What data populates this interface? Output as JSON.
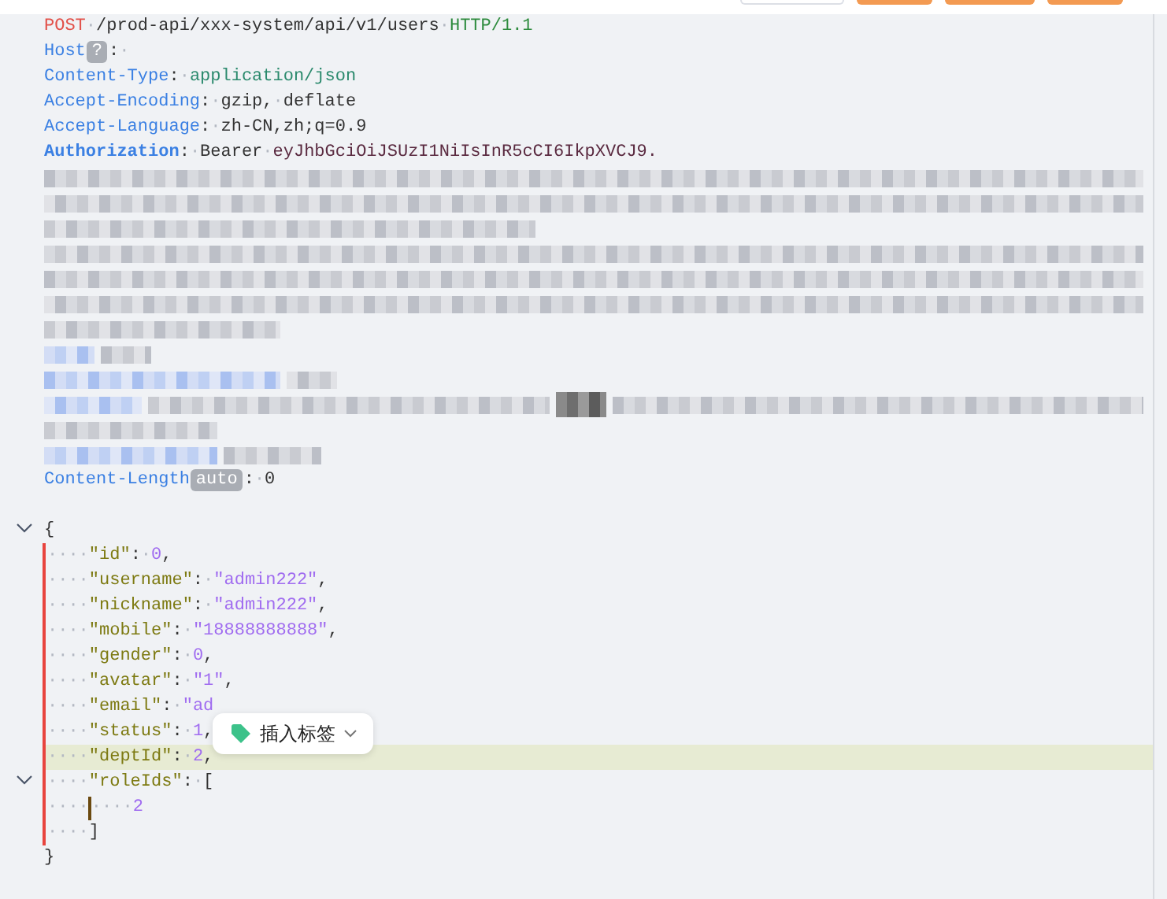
{
  "toolbar": {
    "buttons": [
      {
        "kind": "outline"
      },
      {
        "kind": "primary"
      },
      {
        "kind": "primary"
      },
      {
        "kind": "primary"
      }
    ]
  },
  "editor": {
    "lines": [
      {
        "kind": "code",
        "segments": [
          {
            "kind": "method",
            "text": "POST"
          },
          {
            "kind": "ws",
            "text": "·"
          },
          {
            "kind": "text",
            "text": "/prod-api/xxx-system/api/v1/users"
          },
          {
            "kind": "ws",
            "text": "·"
          },
          {
            "kind": "version",
            "text": "HTTP/1.1"
          }
        ]
      },
      {
        "kind": "code",
        "segments": [
          {
            "kind": "header",
            "text": "Host"
          },
          {
            "kind": "badge",
            "text": "?"
          },
          {
            "kind": "punct",
            "text": ":"
          },
          {
            "kind": "ws",
            "text": "·"
          }
        ]
      },
      {
        "kind": "code",
        "segments": [
          {
            "kind": "header",
            "text": "Content-Type"
          },
          {
            "kind": "punct",
            "text": ":"
          },
          {
            "kind": "ws",
            "text": "·"
          },
          {
            "kind": "mime",
            "text": "application/json"
          }
        ]
      },
      {
        "kind": "code",
        "segments": [
          {
            "kind": "header",
            "text": "Accept-Encoding"
          },
          {
            "kind": "punct",
            "text": ":"
          },
          {
            "kind": "ws",
            "text": "·"
          },
          {
            "kind": "text",
            "text": "gzip,"
          },
          {
            "kind": "ws",
            "text": "·"
          },
          {
            "kind": "text",
            "text": "deflate"
          }
        ]
      },
      {
        "kind": "code",
        "segments": [
          {
            "kind": "header",
            "text": "Accept-Language"
          },
          {
            "kind": "punct",
            "text": ":"
          },
          {
            "kind": "ws",
            "text": "·"
          },
          {
            "kind": "text",
            "text": "zh-CN,zh;q=0.9"
          }
        ]
      },
      {
        "kind": "code",
        "segments": [
          {
            "kind": "header",
            "text": "Authorization"
          },
          {
            "kind": "punct",
            "text": ":"
          },
          {
            "kind": "ws",
            "text": "·"
          },
          {
            "kind": "text",
            "text": "Bearer"
          },
          {
            "kind": "ws",
            "text": "·"
          },
          {
            "kind": "token",
            "text": "eyJhbGciOiJSUzI1NiIsInR5cCI6IkpXVCJ9."
          }
        ]
      },
      {
        "kind": "redacted"
      },
      {
        "kind": "redacted"
      },
      {
        "kind": "redacted"
      },
      {
        "kind": "redacted"
      },
      {
        "kind": "redacted"
      },
      {
        "kind": "redacted"
      },
      {
        "kind": "redacted"
      },
      {
        "kind": "redacted"
      },
      {
        "kind": "redacted"
      },
      {
        "kind": "redacted"
      },
      {
        "kind": "redacted"
      },
      {
        "kind": "redacted"
      },
      {
        "kind": "code",
        "segments": [
          {
            "kind": "header",
            "text": "Content-Length"
          },
          {
            "kind": "badge",
            "text": "auto"
          },
          {
            "kind": "punct",
            "text": ":"
          },
          {
            "kind": "ws",
            "text": "·"
          },
          {
            "kind": "text",
            "text": "0"
          }
        ]
      },
      {
        "kind": "code"
      },
      {
        "kind": "code",
        "foldable": true,
        "segments": [
          {
            "kind": "punct",
            "text": "{"
          }
        ]
      },
      {
        "kind": "code",
        "guide": true,
        "segments": [
          {
            "kind": "ws",
            "text": "····"
          },
          {
            "kind": "key",
            "text": "\"id\""
          },
          {
            "kind": "punct",
            "text": ":"
          },
          {
            "kind": "ws",
            "text": "·"
          },
          {
            "kind": "number",
            "text": "0"
          },
          {
            "kind": "punct",
            "text": ","
          }
        ]
      },
      {
        "kind": "code",
        "guide": true,
        "segments": [
          {
            "kind": "ws",
            "text": "····"
          },
          {
            "kind": "key",
            "text": "\"username\""
          },
          {
            "kind": "punct",
            "text": ":"
          },
          {
            "kind": "ws",
            "text": "·"
          },
          {
            "kind": "string",
            "text": "\"admin222\""
          },
          {
            "kind": "punct",
            "text": ","
          }
        ]
      },
      {
        "kind": "code",
        "guide": true,
        "segments": [
          {
            "kind": "ws",
            "text": "····"
          },
          {
            "kind": "key",
            "text": "\"nickname\""
          },
          {
            "kind": "punct",
            "text": ":"
          },
          {
            "kind": "ws",
            "text": "·"
          },
          {
            "kind": "string",
            "text": "\"admin222\""
          },
          {
            "kind": "punct",
            "text": ","
          }
        ]
      },
      {
        "kind": "code",
        "guide": true,
        "segments": [
          {
            "kind": "ws",
            "text": "····"
          },
          {
            "kind": "key",
            "text": "\"mobile\""
          },
          {
            "kind": "punct",
            "text": ":"
          },
          {
            "kind": "ws",
            "text": "·"
          },
          {
            "kind": "string",
            "text": "\"18888888888\""
          },
          {
            "kind": "punct",
            "text": ","
          }
        ]
      },
      {
        "kind": "code",
        "guide": true,
        "segments": [
          {
            "kind": "ws",
            "text": "····"
          },
          {
            "kind": "key",
            "text": "\"gender\""
          },
          {
            "kind": "punct",
            "text": ":"
          },
          {
            "kind": "ws",
            "text": "·"
          },
          {
            "kind": "number",
            "text": "0"
          },
          {
            "kind": "punct",
            "text": ","
          }
        ]
      },
      {
        "kind": "code",
        "guide": true,
        "segments": [
          {
            "kind": "ws",
            "text": "····"
          },
          {
            "kind": "key",
            "text": "\"avatar\""
          },
          {
            "kind": "punct",
            "text": ":"
          },
          {
            "kind": "ws",
            "text": "·"
          },
          {
            "kind": "string",
            "text": "\"1\""
          },
          {
            "kind": "punct",
            "text": ","
          }
        ]
      },
      {
        "kind": "code",
        "guide": true,
        "segments": [
          {
            "kind": "ws",
            "text": "····"
          },
          {
            "kind": "key",
            "text": "\"email\""
          },
          {
            "kind": "punct",
            "text": ":"
          },
          {
            "kind": "ws",
            "text": "·"
          },
          {
            "kind": "string",
            "text": "\"ad"
          }
        ]
      },
      {
        "kind": "code",
        "guide": true,
        "segments": [
          {
            "kind": "ws",
            "text": "····"
          },
          {
            "kind": "key",
            "text": "\"status\""
          },
          {
            "kind": "punct",
            "text": ":"
          },
          {
            "kind": "ws",
            "text": "·"
          },
          {
            "kind": "number",
            "text": "1"
          },
          {
            "kind": "punct",
            "text": ","
          }
        ]
      },
      {
        "kind": "code",
        "guide": true,
        "current": true,
        "segments": [
          {
            "kind": "ws",
            "text": "····"
          },
          {
            "kind": "key",
            "text": "\"deptId\""
          },
          {
            "kind": "punct",
            "text": ":"
          },
          {
            "kind": "ws",
            "text": "·"
          },
          {
            "kind": "number",
            "text": "2"
          },
          {
            "kind": "punct",
            "text": ","
          }
        ]
      },
      {
        "kind": "code",
        "guide": true,
        "foldable": true,
        "segments": [
          {
            "kind": "ws",
            "text": "····"
          },
          {
            "kind": "key",
            "text": "\"roleIds\""
          },
          {
            "kind": "punct",
            "text": ":"
          },
          {
            "kind": "ws",
            "text": "·"
          },
          {
            "kind": "punct",
            "text": "["
          }
        ]
      },
      {
        "kind": "code",
        "guide": true,
        "segments": [
          {
            "kind": "ws",
            "text": "····"
          },
          {
            "kind": "cursor"
          },
          {
            "kind": "ws",
            "text": "····"
          },
          {
            "kind": "number",
            "text": "2"
          }
        ]
      },
      {
        "kind": "code",
        "guide": true,
        "segments": [
          {
            "kind": "ws",
            "text": "····"
          },
          {
            "kind": "punct",
            "text": "]"
          }
        ]
      },
      {
        "kind": "code",
        "segments": [
          {
            "kind": "punct",
            "text": "}"
          }
        ]
      }
    ],
    "popup": {
      "label": "插入标签"
    }
  }
}
